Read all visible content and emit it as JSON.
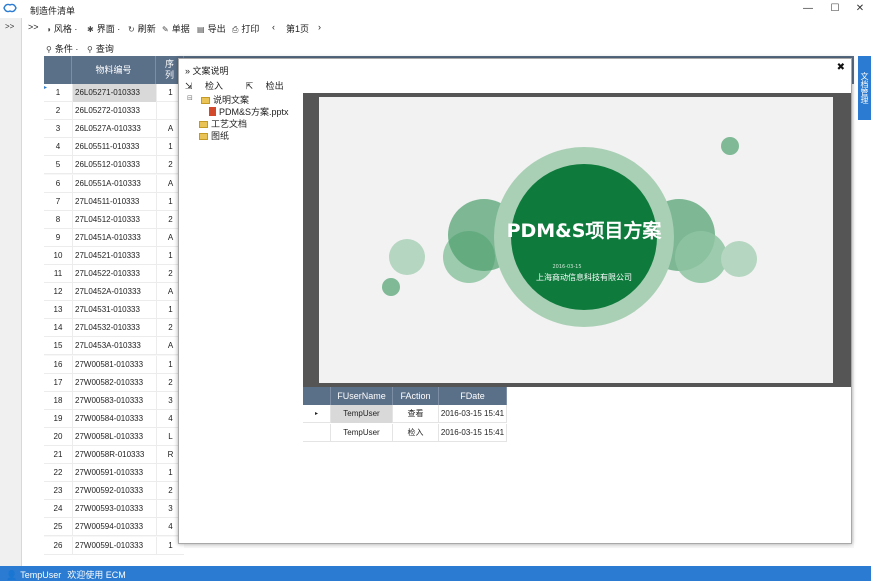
{
  "window": {
    "title": "制造件清单",
    "controls": {
      "minimize": "—",
      "maximize": "☐",
      "close": "✕"
    }
  },
  "rail": {
    "toggle": ">>"
  },
  "toolbar": {
    "toggle": ">>",
    "style": "风格",
    "layout": "界面",
    "refresh": "刷新",
    "record": "单据",
    "export": "导出",
    "print": "打印",
    "prev": "‹",
    "page": "第1页",
    "next": "›",
    "condition": "条件",
    "query": "查询"
  },
  "grid": {
    "columns": {
      "code": "物料编号",
      "seq": "序列"
    },
    "rows": [
      {
        "idx": "1",
        "code": "26L05271-010333",
        "seq": "1"
      },
      {
        "idx": "2",
        "code": "26L05272-010333",
        "seq": ""
      },
      {
        "idx": "3",
        "code": "26L0527A-010333",
        "seq": "A"
      },
      {
        "idx": "4",
        "code": "26L05511-010333",
        "seq": "1"
      },
      {
        "idx": "5",
        "code": "26L05512-010333",
        "seq": "2"
      },
      {
        "idx": "6",
        "code": "26L0551A-010333",
        "seq": "A"
      },
      {
        "idx": "7",
        "code": "27L04511-010333",
        "seq": "1"
      },
      {
        "idx": "8",
        "code": "27L04512-010333",
        "seq": "2"
      },
      {
        "idx": "9",
        "code": "27L0451A-010333",
        "seq": "A"
      },
      {
        "idx": "10",
        "code": "27L04521-010333",
        "seq": "1"
      },
      {
        "idx": "11",
        "code": "27L04522-010333",
        "seq": "2"
      },
      {
        "idx": "12",
        "code": "27L0452A-010333",
        "seq": "A"
      },
      {
        "idx": "13",
        "code": "27L04531-010333",
        "seq": "1"
      },
      {
        "idx": "14",
        "code": "27L04532-010333",
        "seq": "2"
      },
      {
        "idx": "15",
        "code": "27L0453A-010333",
        "seq": "A"
      },
      {
        "idx": "16",
        "code": "27W00581-010333",
        "seq": "1"
      },
      {
        "idx": "17",
        "code": "27W00582-010333",
        "seq": "2"
      },
      {
        "idx": "18",
        "code": "27W00583-010333",
        "seq": "3"
      },
      {
        "idx": "19",
        "code": "27W00584-010333",
        "seq": "4"
      },
      {
        "idx": "20",
        "code": "27W0058L-010333",
        "seq": "L"
      },
      {
        "idx": "21",
        "code": "27W0058R-010333",
        "seq": "R"
      },
      {
        "idx": "22",
        "code": "27W00591-010333",
        "seq": "1"
      },
      {
        "idx": "23",
        "code": "27W00592-010333",
        "seq": "2"
      },
      {
        "idx": "24",
        "code": "27W00593-010333",
        "seq": "3"
      },
      {
        "idx": "25",
        "code": "27W00594-010333",
        "seq": "4"
      },
      {
        "idx": "26",
        "code": "27W0059L-010333",
        "seq": "1"
      }
    ]
  },
  "side_tab": "文档管理",
  "dialog": {
    "title": "文案说明",
    "close": "✖",
    "checkin": "检入",
    "checkout": "检出",
    "tree": {
      "collapse": "⊟",
      "root": "说明文案",
      "file": "PDM&S方案.pptx",
      "folder2": "工艺文档",
      "folder3": "图纸"
    },
    "slide": {
      "title": "PDM&S项目方案",
      "date": "2016-03-15",
      "company": "上海商动信息科技有限公司"
    },
    "log": {
      "columns": [
        "FUserName",
        "FAction",
        "FDate"
      ],
      "rows": [
        {
          "user": "TempUser",
          "action": "查看",
          "date": "2016-03-15 15:41"
        },
        {
          "user": "TempUser",
          "action": "检入",
          "date": "2016-03-15 15:41"
        }
      ]
    }
  },
  "status": {
    "user": "TempUser",
    "welcome": "欢迎使用 ECM"
  },
  "colors": {
    "header": "#5a6f88",
    "accent": "#2a7bd1",
    "slide_green": "#0e7a3c"
  }
}
